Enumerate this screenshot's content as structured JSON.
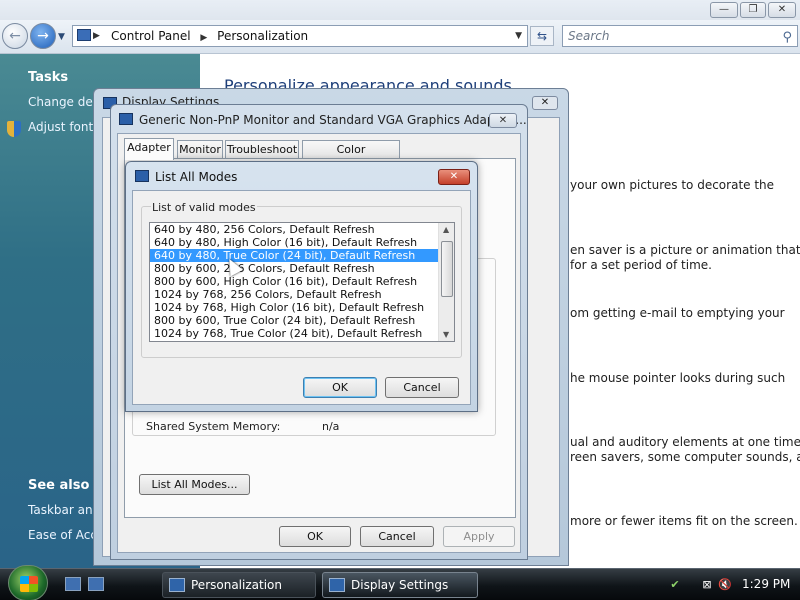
{
  "explorer": {
    "breadcrumb": [
      "Control Panel",
      "Personalization"
    ],
    "search_placeholder": "Search",
    "title_buttons": {
      "minimize": "—",
      "restore": "❐",
      "close": "✕"
    }
  },
  "sidebar": {
    "tasks_heading": "Tasks",
    "tasks": [
      "Change desk",
      "Adjust font s"
    ],
    "see_also_heading": "See also",
    "see_also": [
      "Taskbar and",
      "Ease of Acce"
    ]
  },
  "main": {
    "title": "Personalize appearance and sounds",
    "texts": [
      "your own pictures to decorate the",
      "en saver is a picture or animation that",
      "for a set period of time.",
      "om getting e-mail to emptying your",
      "he mouse pointer looks during such",
      "ual and auditory elements at one time",
      "reen savers, some computer sounds, and",
      "more or fewer items fit on the screen."
    ]
  },
  "display_settings": {
    "title": "Display Settings"
  },
  "adapter_dialog": {
    "title": "Generic Non-PnP Monitor and Standard VGA Graphics Adapter ...",
    "close": "✕",
    "tabs": [
      "Adapter",
      "Monitor",
      "Troubleshoot",
      "Color Management"
    ],
    "shared_memory_label": "Shared System Memory:",
    "shared_memory_value": "n/a",
    "list_all_modes": "List All Modes...",
    "ok": "OK",
    "cancel": "Cancel",
    "apply": "Apply"
  },
  "modes_dialog": {
    "title": "List All Modes",
    "close": "✕",
    "group_label": "List of valid modes",
    "modes": [
      "640 by 480, 256 Colors, Default Refresh",
      "640 by 480, High Color (16 bit), Default Refresh",
      "640 by 480, True Color (24 bit), Default Refresh",
      "800 by 600, 256 Colors, Default Refresh",
      "800 by 600, High Color (16 bit), Default Refresh",
      "1024 by 768, 256 Colors, Default Refresh",
      "1024 by 768, High Color (16 bit), Default Refresh",
      "800 by 600, True Color (24 bit), Default Refresh",
      "1024 by 768, True Color (24 bit), Default Refresh"
    ],
    "selected_index": 2,
    "ok": "OK",
    "cancel": "Cancel"
  },
  "taskbar": {
    "buttons": [
      "Personalization",
      "Display Settings"
    ],
    "clock": "1:29 PM"
  }
}
